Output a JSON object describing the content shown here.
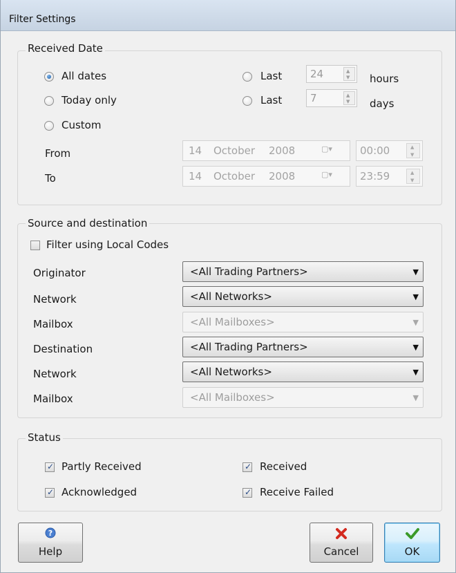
{
  "window": {
    "title": "Filter Settings"
  },
  "received_date": {
    "group_label": "Received Date",
    "options": {
      "all_dates": "All dates",
      "today_only": "Today only",
      "custom": "Custom",
      "last": "Last"
    },
    "last_hours": {
      "value": "24",
      "unit": "hours"
    },
    "last_days": {
      "value": "7",
      "unit": "days"
    },
    "from": {
      "label": "From",
      "day": "14",
      "month": "October",
      "year": "2008",
      "time": "00:00"
    },
    "to": {
      "label": "To",
      "day": "14",
      "month": "October",
      "year": "2008",
      "time": "23:59"
    },
    "selected": "All dates"
  },
  "source_destination": {
    "group_label": "Source and destination",
    "local_codes_label": "Filter using Local Codes",
    "rows": [
      {
        "label": "Originator",
        "value": "<All Trading Partners>",
        "enabled": true
      },
      {
        "label": "Network",
        "value": "<All Networks>",
        "enabled": true
      },
      {
        "label": "Mailbox",
        "value": "<All Mailboxes>",
        "enabled": false
      },
      {
        "label": "Destination",
        "value": "<All Trading Partners>",
        "enabled": true
      },
      {
        "label": "Network",
        "value": "<All Networks>",
        "enabled": true
      },
      {
        "label": "Mailbox",
        "value": "<All Mailboxes>",
        "enabled": false
      }
    ]
  },
  "status": {
    "group_label": "Status",
    "partly_received": "Partly Received",
    "received": "Received",
    "acknowledged": "Acknowledged",
    "receive_failed": "Receive Failed"
  },
  "buttons": {
    "help": "Help",
    "cancel": "Cancel",
    "ok": "OK"
  },
  "colors": {
    "accent": "#1e5fa8",
    "cancel_icon": "#d32a1f",
    "ok_icon": "#3a9a2a",
    "help_icon": "#4a7fd0"
  }
}
